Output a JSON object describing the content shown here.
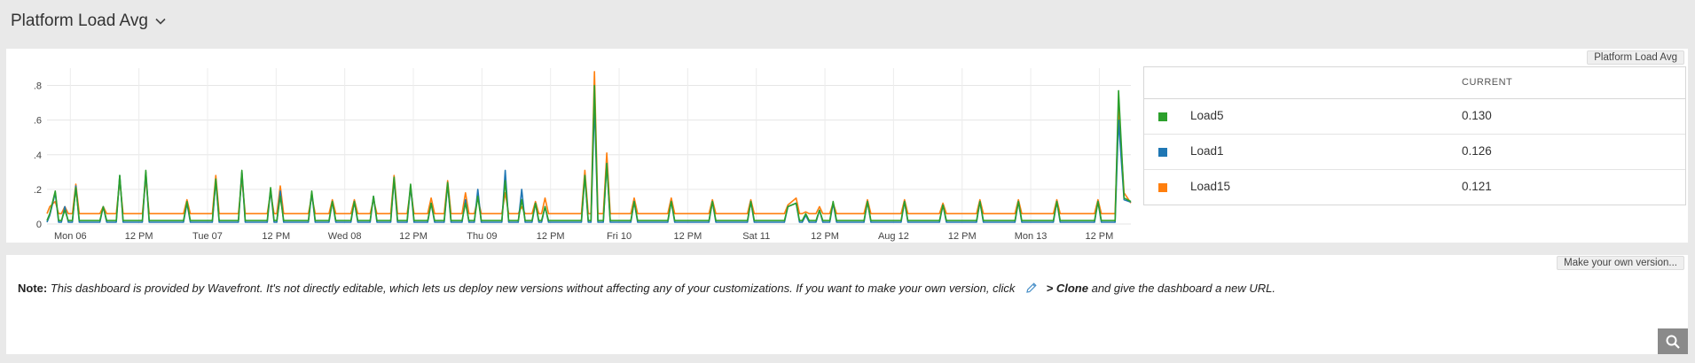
{
  "page": {
    "title": "Platform Load Avg"
  },
  "chart_panel": {
    "chip_label": "Platform Load Avg"
  },
  "legend": {
    "column_header": "CURRENT",
    "rows": [
      {
        "name": "Load5",
        "value": "0.130",
        "color": "#2ca02c"
      },
      {
        "name": "Load1",
        "value": "0.126",
        "color": "#1f77b4"
      },
      {
        "name": "Load15",
        "value": "0.121",
        "color": "#ff7f0e"
      }
    ]
  },
  "chart_data": {
    "type": "line",
    "title": "Platform Load Avg",
    "xlabel": "",
    "ylabel": "",
    "ylim": [
      0,
      0.9
    ],
    "yticks": [
      "0",
      ".2",
      ".4",
      ".6",
      ".8"
    ],
    "grid": true,
    "legend_position": "right",
    "x_tick_labels": [
      "Mon 06",
      "12 PM",
      "Tue 07",
      "12 PM",
      "Wed 08",
      "12 PM",
      "Thu 09",
      "12 PM",
      "Fri 10",
      "12 PM",
      "Sat 11",
      "12 PM",
      "Aug 12",
      "12 PM",
      "Mon 13",
      "12 PM"
    ],
    "x_range_days": [
      0,
      7.9
    ],
    "x_tick_days": [
      0.17,
      0.67,
      1.17,
      1.67,
      2.17,
      2.67,
      3.17,
      3.67,
      4.17,
      4.67,
      5.17,
      5.67,
      6.17,
      6.67,
      7.17,
      7.67
    ],
    "baseline": {
      "Load1": 0.01,
      "Load5": 0.02,
      "Load15": 0.06
    },
    "peaks": [
      {
        "day": 0.02,
        "Load1": 0.05,
        "Load5": 0.06,
        "Load15": 0.1
      },
      {
        "day": 0.06,
        "Load1": 0.18,
        "Load5": 0.19,
        "Load15": 0.13
      },
      {
        "day": 0.13,
        "Load1": 0.1,
        "Load5": 0.08,
        "Load15": 0.1
      },
      {
        "day": 0.21,
        "Load1": 0.22,
        "Load5": 0.21,
        "Load15": 0.23
      },
      {
        "day": 0.41,
        "Load1": 0.1,
        "Load5": 0.1,
        "Load15": 0.1
      },
      {
        "day": 0.53,
        "Load1": 0.28,
        "Load5": 0.28,
        "Load15": 0.25
      },
      {
        "day": 0.72,
        "Load1": 0.3,
        "Load5": 0.31,
        "Load15": 0.26
      },
      {
        "day": 1.02,
        "Load1": 0.12,
        "Load5": 0.13,
        "Load15": 0.14
      },
      {
        "day": 1.23,
        "Load1": 0.25,
        "Load5": 0.26,
        "Load15": 0.28
      },
      {
        "day": 1.42,
        "Load1": 0.3,
        "Load5": 0.31,
        "Load15": 0.26
      },
      {
        "day": 1.63,
        "Load1": 0.2,
        "Load5": 0.21,
        "Load15": 0.18
      },
      {
        "day": 1.7,
        "Load1": 0.19,
        "Load5": 0.16,
        "Load15": 0.22
      },
      {
        "day": 1.93,
        "Load1": 0.18,
        "Load5": 0.19,
        "Load15": 0.16
      },
      {
        "day": 2.08,
        "Load1": 0.13,
        "Load5": 0.13,
        "Load15": 0.14
      },
      {
        "day": 2.24,
        "Load1": 0.13,
        "Load5": 0.13,
        "Load15": 0.14
      },
      {
        "day": 2.38,
        "Load1": 0.16,
        "Load5": 0.16,
        "Load15": 0.14
      },
      {
        "day": 2.53,
        "Load1": 0.26,
        "Load5": 0.27,
        "Load15": 0.28
      },
      {
        "day": 2.65,
        "Load1": 0.22,
        "Load5": 0.23,
        "Load15": 0.2
      },
      {
        "day": 2.8,
        "Load1": 0.12,
        "Load5": 0.12,
        "Load15": 0.15
      },
      {
        "day": 2.92,
        "Load1": 0.23,
        "Load5": 0.24,
        "Load15": 0.25
      },
      {
        "day": 3.05,
        "Load1": 0.14,
        "Load5": 0.12,
        "Load15": 0.18
      },
      {
        "day": 3.14,
        "Load1": 0.2,
        "Load5": 0.16,
        "Load15": 0.15
      },
      {
        "day": 3.34,
        "Load1": 0.31,
        "Load5": 0.25,
        "Load15": 0.18
      },
      {
        "day": 3.46,
        "Load1": 0.2,
        "Load5": 0.14,
        "Load15": 0.1
      },
      {
        "day": 3.56,
        "Load1": 0.12,
        "Load5": 0.12,
        "Load15": 0.13
      },
      {
        "day": 3.63,
        "Load1": 0.1,
        "Load5": 0.1,
        "Load15": 0.15
      },
      {
        "day": 3.92,
        "Load1": 0.28,
        "Load5": 0.28,
        "Load15": 0.31
      },
      {
        "day": 3.99,
        "Load1": 0.7,
        "Load5": 0.8,
        "Load15": 0.88
      },
      {
        "day": 4.08,
        "Load1": 0.35,
        "Load5": 0.35,
        "Load15": 0.41
      },
      {
        "day": 4.28,
        "Load1": 0.13,
        "Load5": 0.13,
        "Load15": 0.15
      },
      {
        "day": 4.55,
        "Load1": 0.13,
        "Load5": 0.13,
        "Load15": 0.15
      },
      {
        "day": 4.85,
        "Load1": 0.13,
        "Load5": 0.13,
        "Load15": 0.14
      },
      {
        "day": 5.13,
        "Load1": 0.13,
        "Load5": 0.13,
        "Load15": 0.14
      },
      {
        "day": 5.4,
        "Load1": 0.1,
        "Load5": 0.1,
        "Load15": 0.11
      },
      {
        "day": 5.46,
        "Load1": 0.12,
        "Load5": 0.12,
        "Load15": 0.15
      },
      {
        "day": 5.53,
        "Load1": 0.05,
        "Load5": 0.06,
        "Load15": 0.07
      },
      {
        "day": 5.63,
        "Load1": 0.08,
        "Load5": 0.08,
        "Load15": 0.1
      },
      {
        "day": 5.73,
        "Load1": 0.12,
        "Load5": 0.13,
        "Load15": 0.12
      },
      {
        "day": 5.98,
        "Load1": 0.13,
        "Load5": 0.13,
        "Load15": 0.14
      },
      {
        "day": 6.25,
        "Load1": 0.13,
        "Load5": 0.13,
        "Load15": 0.14
      },
      {
        "day": 6.53,
        "Load1": 0.11,
        "Load5": 0.11,
        "Load15": 0.12
      },
      {
        "day": 6.8,
        "Load1": 0.13,
        "Load5": 0.13,
        "Load15": 0.14
      },
      {
        "day": 7.08,
        "Load1": 0.13,
        "Load5": 0.13,
        "Load15": 0.14
      },
      {
        "day": 7.36,
        "Load1": 0.13,
        "Load5": 0.13,
        "Load15": 0.14
      },
      {
        "day": 7.66,
        "Load1": 0.13,
        "Load5": 0.13,
        "Load15": 0.14
      },
      {
        "day": 7.81,
        "Load1": 0.6,
        "Load5": 0.77,
        "Load15": 0.68
      },
      {
        "day": 7.85,
        "Load1": 0.14,
        "Load5": 0.15,
        "Load15": 0.18
      },
      {
        "day": 7.9,
        "Load1": 0.126,
        "Load5": 0.13,
        "Load15": 0.121
      }
    ]
  },
  "note_panel": {
    "chip_label": "Make your own version...",
    "note_label": "Note:",
    "note_text": "This dashboard is provided by Wavefront. It's not directly editable, which lets us deploy new versions without affecting any of your customizations. If you want to make your own version, click",
    "clone_label": "> Clone",
    "note_tail": "and give the dashboard a new URL."
  }
}
